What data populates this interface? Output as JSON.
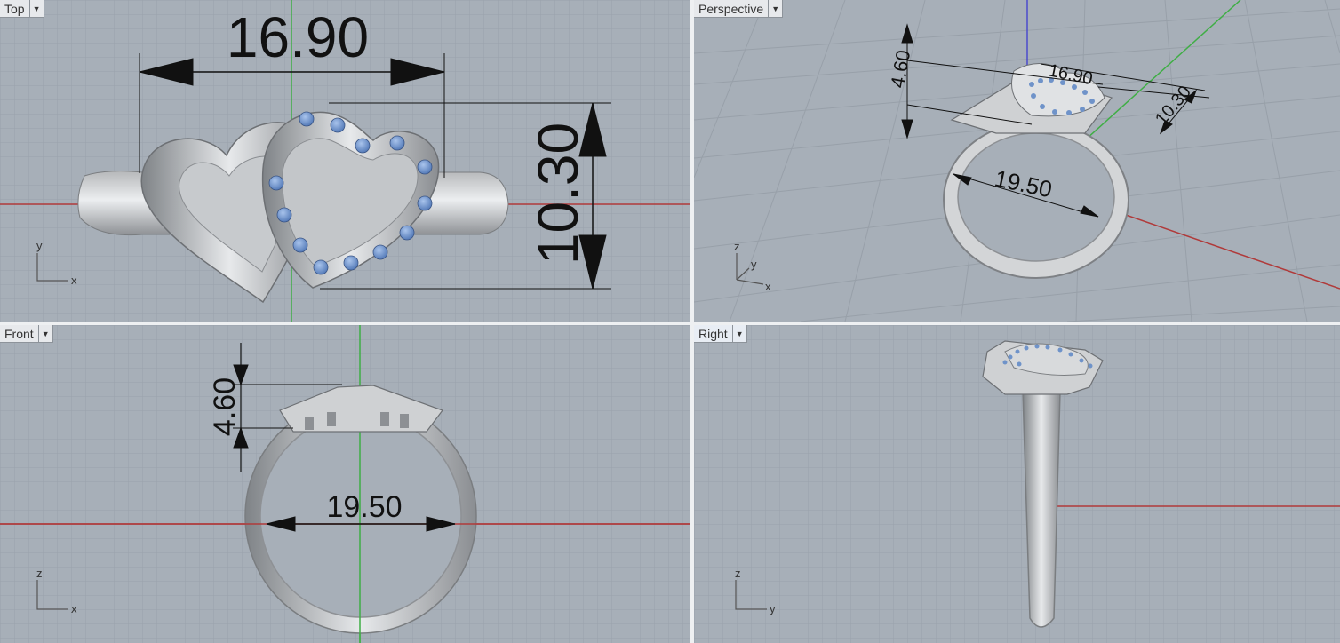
{
  "viewports": {
    "top": {
      "label": "Top"
    },
    "perspective": {
      "label": "Perspective"
    },
    "front": {
      "label": "Front"
    },
    "right": {
      "label": "Right"
    }
  },
  "dimensions": {
    "top_width": "16.90",
    "top_height": "10.30",
    "persp_width": "16.90",
    "persp_depth": "10.30",
    "persp_height": "4.60",
    "persp_diameter": "19.50",
    "front_height": "4.60",
    "front_diameter": "19.50"
  },
  "axes": {
    "top": {
      "h": "x",
      "v": "y"
    },
    "perspective": {
      "a": "z",
      "b": "y",
      "c": "x"
    },
    "front": {
      "h": "x",
      "v": "z"
    },
    "right": {
      "h": "y",
      "v": "z"
    }
  },
  "colors": {
    "viewport_bg": "#a7afb8",
    "grid_minor": "#9aa2ab",
    "grid_major": "#8a929b",
    "x_axis": "#b03a3a",
    "y_axis": "#3fae45",
    "z_axis": "#4b4bcc",
    "gem": "#6f93c9",
    "metal": "#cfd1d3"
  },
  "icons": {
    "viewport_menu": "dropdown-triangle-icon"
  }
}
